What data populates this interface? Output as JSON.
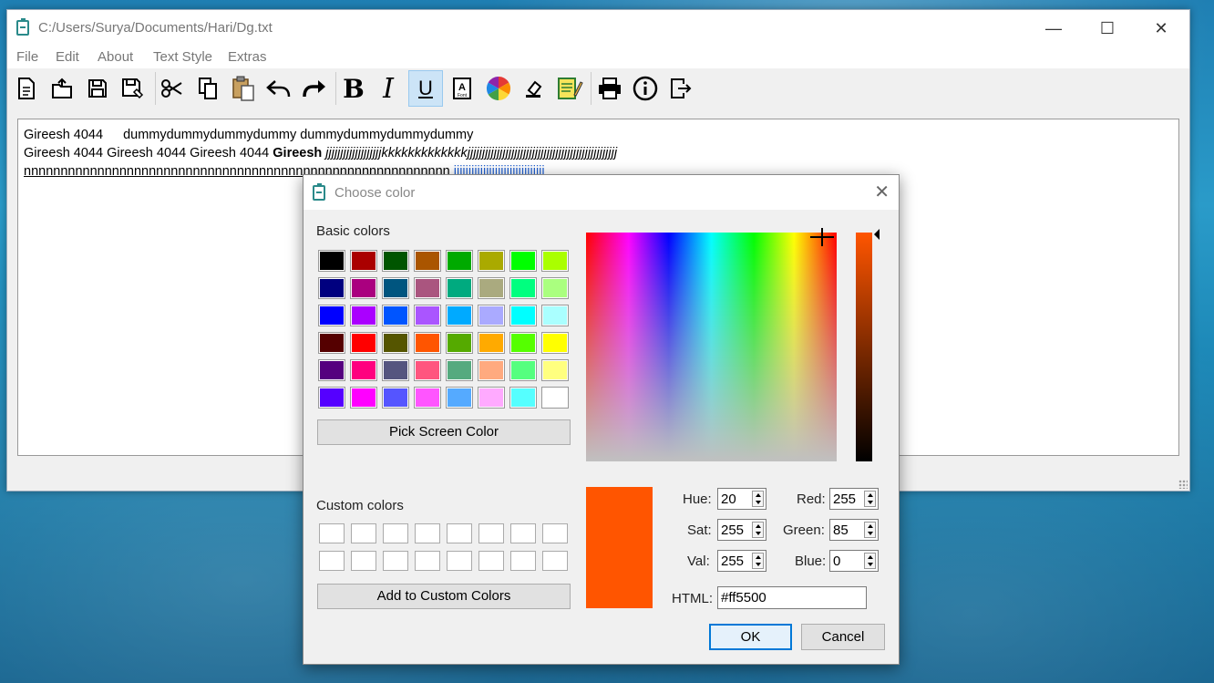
{
  "main_window": {
    "title": "C:/Users/Surya/Documents/Hari/Dg.txt",
    "controls": {
      "minimize": "—",
      "maximize": "☐",
      "close": "✕"
    },
    "menu": [
      "File",
      "Edit",
      "About",
      "Text Style",
      "Extras"
    ],
    "toolbar": {
      "bold_label": "B",
      "italic_label": "I",
      "underline_label": "U",
      "font_label": "Font",
      "underline_active": true
    },
    "editor": {
      "line1_a": "Gireesh 4044",
      "line1_b": "dummydummydummydummy dummydummydummydummy",
      "line2_a": "Gireesh 4044 Gireesh 4044 Gireesh 4044 ",
      "line2_bold": "Gireesh",
      "line2_italic": " jjjjjjjjjjjjjjjjjjjkkkkkkkkkkkkkjjjjjjjjjjjjjjjjjjjjjjjjjjjjjjjjjjjjjjjjjjjjjjjjjjj",
      "line3_underlined": "nnnnnnnnnnnnnnnnnnnnnnnnnnnnnnnnnnnnnnnnnnnnnnnnnnnnnnnnnn",
      "line3_selected": "jjjjjjjjjjjjjjjjjjjjjjjjjjjjjjj"
    }
  },
  "color_dialog": {
    "title": "Choose color",
    "close": "✕",
    "basic_colors_label": "Basic colors",
    "basic_colors": [
      "#000000",
      "#aa0000",
      "#005500",
      "#aa5500",
      "#00aa00",
      "#aaaa00",
      "#00ff00",
      "#aaff00",
      "#00007f",
      "#aa007f",
      "#00557f",
      "#aa557f",
      "#00aa7f",
      "#aaaa7f",
      "#00ff7f",
      "#aaff7f",
      "#0000ff",
      "#aa00ff",
      "#0055ff",
      "#aa55ff",
      "#00aaff",
      "#aaaaff",
      "#00ffff",
      "#aaffff",
      "#550000",
      "#ff0000",
      "#555500",
      "#ff5500",
      "#55aa00",
      "#ffaa00",
      "#55ff00",
      "#ffff00",
      "#55007f",
      "#ff007f",
      "#55557f",
      "#ff557f",
      "#55aa7f",
      "#ffaa7f",
      "#55ff7f",
      "#ffff7f",
      "#5500ff",
      "#ff00ff",
      "#5555ff",
      "#ff55ff",
      "#55aaff",
      "#ffaaff",
      "#55ffff",
      "#ffffff"
    ],
    "pick_screen_color": "Pick Screen Color",
    "custom_colors_label": "Custom colors",
    "custom_colors_count": 16,
    "add_custom": "Add to Custom Colors",
    "current_color": "#ff5500",
    "fields": {
      "hue_label": "Hue:",
      "hue": "20",
      "sat_label": "Sat:",
      "sat": "255",
      "val_label": "Val:",
      "val": "255",
      "red_label": "Red:",
      "red": "255",
      "green_label": "Green:",
      "green": "85",
      "blue_label": "Blue:",
      "blue": "0",
      "html_label": "HTML:",
      "html": "#ff5500"
    },
    "ok": "OK",
    "cancel": "Cancel"
  }
}
